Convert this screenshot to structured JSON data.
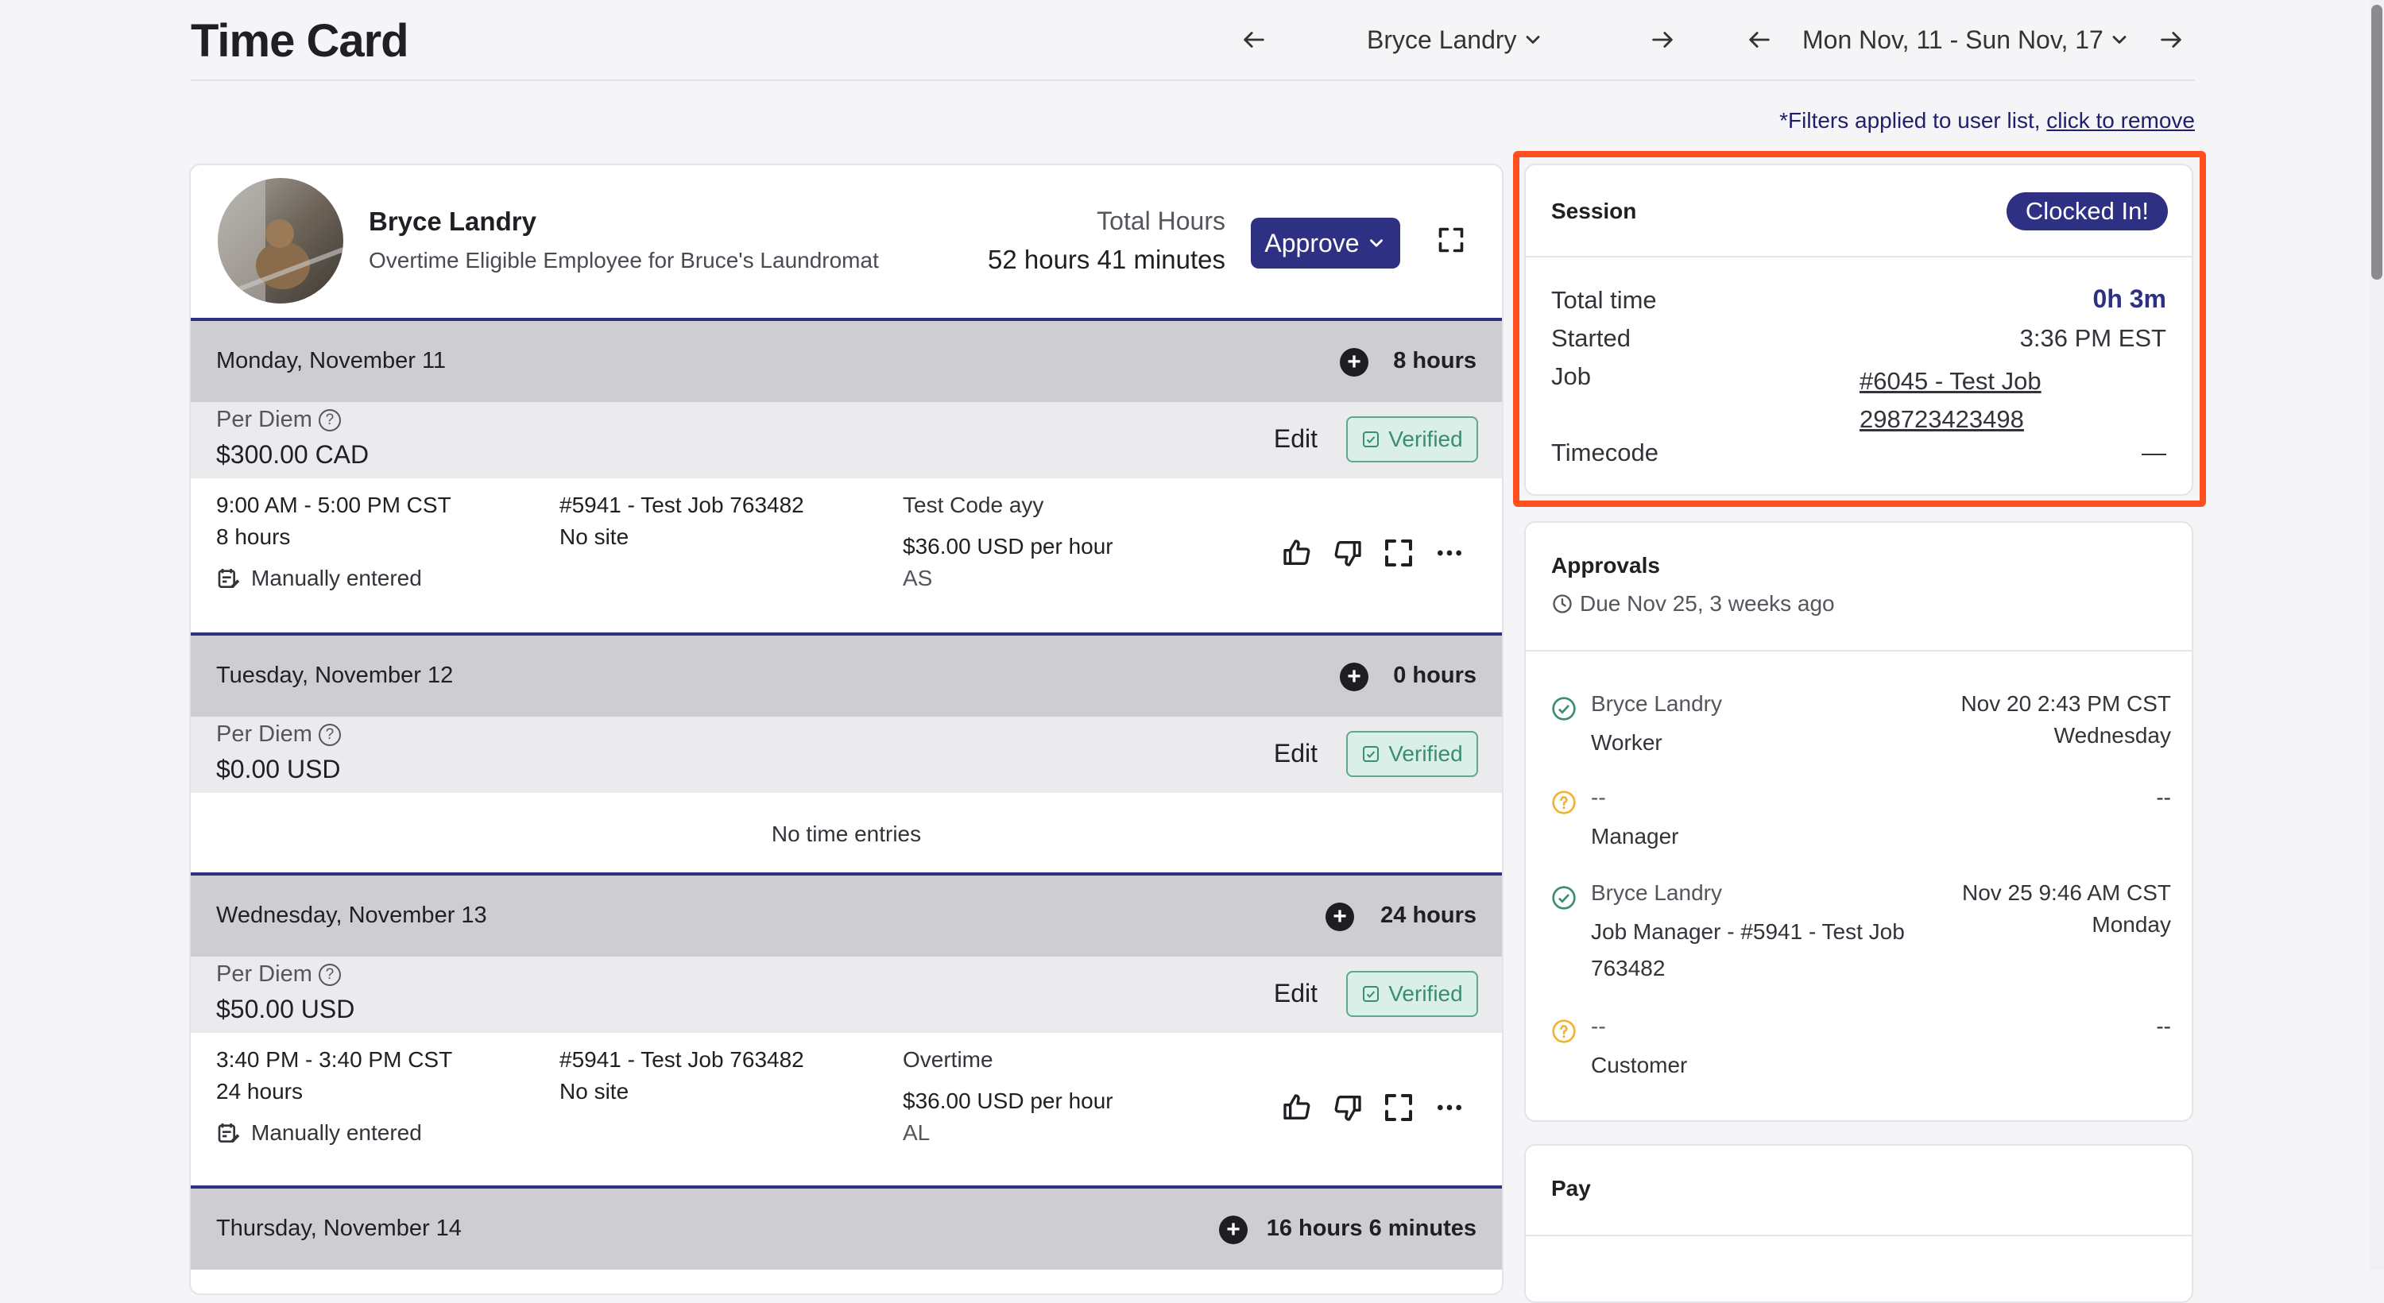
{
  "header": {
    "title": "Time Card",
    "employee_select": "Bryce Landry",
    "date_range": "Mon Nov, 11 - Sun Nov, 17"
  },
  "filter_note": {
    "text": "*Filters applied to user list, ",
    "link": "click to remove"
  },
  "employee": {
    "name": "Bryce Landry",
    "subtitle": "Overtime Eligible Employee for Bruce's Laundromat",
    "total_hours_label": "Total Hours",
    "total_hours_value": "52 hours 41 minutes",
    "approve_label": "Approve"
  },
  "days": [
    {
      "name": "Monday, November 11",
      "hours": "8 hours",
      "per_diem_label": "Per Diem",
      "per_diem_amount": "$300.00 CAD",
      "edit_label": "Edit",
      "verified_label": "Verified",
      "entry": {
        "time": "9:00 AM - 5:00 PM CST",
        "duration": "8 hours",
        "source": "Manually entered",
        "job": "#5941 - Test Job 763482",
        "site": "No site",
        "code": "Test Code ayy",
        "rate": "$36.00 USD per hour",
        "initials": "AS"
      }
    },
    {
      "name": "Tuesday, November 12",
      "hours": "0 hours",
      "per_diem_label": "Per Diem",
      "per_diem_amount": "$0.00 USD",
      "edit_label": "Edit",
      "verified_label": "Verified",
      "no_entries": "No time entries"
    },
    {
      "name": "Wednesday, November 13",
      "hours": "24 hours",
      "per_diem_label": "Per Diem",
      "per_diem_amount": "$50.00 USD",
      "edit_label": "Edit",
      "verified_label": "Verified",
      "entry": {
        "time": "3:40 PM - 3:40 PM CST",
        "duration": "24 hours",
        "source": "Manually entered",
        "job": "#5941 - Test Job 763482",
        "site": "No site",
        "code": "Overtime",
        "rate": "$36.00 USD per hour",
        "initials": "AL"
      }
    },
    {
      "name": "Thursday, November 14",
      "hours": "16 hours 6 minutes"
    }
  ],
  "session": {
    "title": "Session",
    "status": "Clocked In!",
    "total_time_label": "Total time",
    "total_time_value": "0h 3m",
    "started_label": "Started",
    "started_value": "3:36 PM EST",
    "job_label": "Job",
    "job_value_line1": "#6045 - Test Job",
    "job_value_line2": "298723423498",
    "timecode_label": "Timecode",
    "timecode_value": "—"
  },
  "approvals": {
    "title": "Approvals",
    "due": "Due Nov 25, 3 weeks ago",
    "items": [
      {
        "status": "approved",
        "name": "Bryce Landry",
        "role": "Worker",
        "date": "Nov 20 2:43 PM CST",
        "day": "Wednesday"
      },
      {
        "status": "pending",
        "name": "--",
        "role": "Manager",
        "date": "--",
        "day": ""
      },
      {
        "status": "approved",
        "name": "Bryce Landry",
        "role": "Job Manager - #5941 - Test Job 763482",
        "date": "Nov 25 9:46 AM CST",
        "day": "Monday"
      },
      {
        "status": "pending",
        "name": "--",
        "role": "Customer",
        "date": "--",
        "day": ""
      }
    ]
  },
  "pay": {
    "title": "Pay"
  },
  "colors": {
    "primary": "#2e3183",
    "verified": "#3a8d72",
    "highlight": "#ff4f1f",
    "pending": "#f2b233"
  }
}
